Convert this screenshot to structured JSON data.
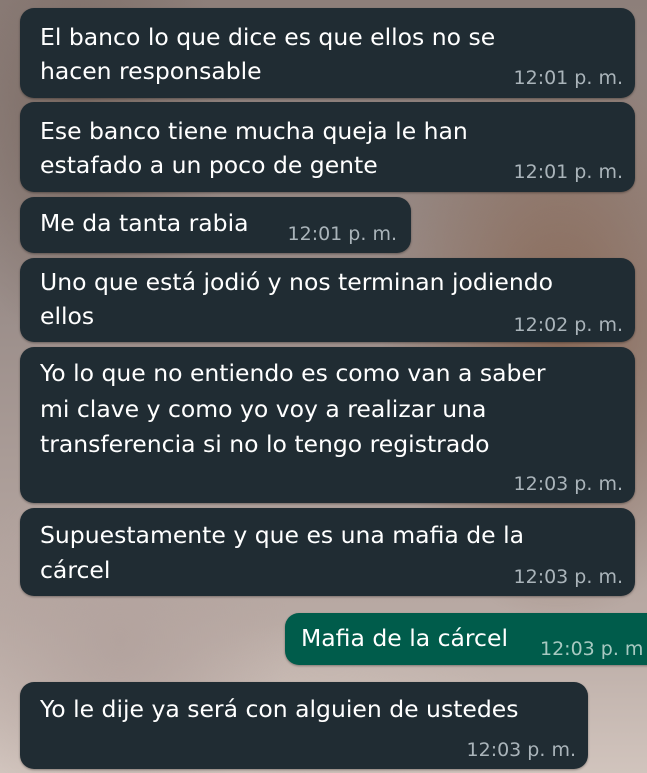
{
  "messages": [
    {
      "direction": "in",
      "lines": [
        "El banco lo que dice es que ellos no se",
        "hacen responsable"
      ],
      "time": "12:01 p. m."
    },
    {
      "direction": "in",
      "lines": [
        "Ese banco tiene mucha queja le han",
        "estafado a un poco de gente"
      ],
      "time": "12:01 p. m."
    },
    {
      "direction": "in",
      "lines": [
        "Me da tanta rabia"
      ],
      "time": "12:01 p. m."
    },
    {
      "direction": "in",
      "lines": [
        "Uno que está jodió y nos terminan jodiendo",
        "ellos"
      ],
      "time": "12:02 p. m."
    },
    {
      "direction": "in",
      "lines": [
        "Yo lo que no entiendo es como van a saber",
        "mi clave y como yo voy a realizar una",
        "transferencia si no lo tengo registrado"
      ],
      "time": "12:03 p. m."
    },
    {
      "direction": "in",
      "lines": [
        "Supuestamente y que es una mafia de la",
        "cárcel"
      ],
      "time": "12:03 p. m."
    },
    {
      "direction": "out",
      "lines": [
        "Mafia de la cárcel"
      ],
      "time": "12:03 p. m"
    },
    {
      "direction": "in",
      "lines": [
        "Yo le dije ya será con alguien de ustedes"
      ],
      "time": "12:03 p. m."
    }
  ],
  "colors": {
    "incoming_bubble": "#202c33",
    "outgoing_bubble": "#005c4b",
    "timestamp": "#aab4ba",
    "text": "#ffffff"
  }
}
